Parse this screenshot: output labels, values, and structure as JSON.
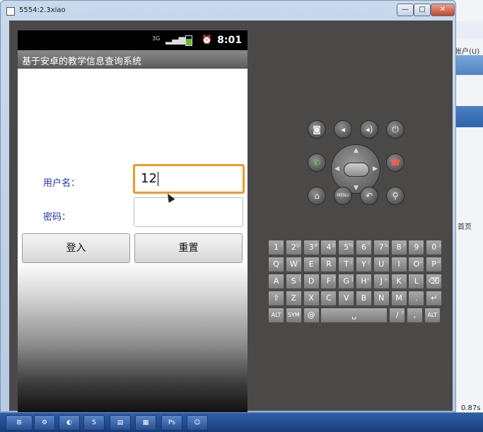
{
  "window": {
    "title": "5554:2.3xiao",
    "minimize_label": "—",
    "maximize_label": "□",
    "close_label": "✕"
  },
  "status_bar": {
    "network_label": "3G",
    "time": "8:01"
  },
  "app": {
    "title": "基于安卓的教学信息查询系统",
    "username_label": "用户名：",
    "username_value": "12",
    "password_label": "密码：",
    "login_button": "登入",
    "reset_button": "重置"
  },
  "hardware": {
    "menu_label": "MENU"
  },
  "keyboard": {
    "rows": [
      [
        {
          "k": "1",
          "a": "!"
        },
        {
          "k": "2",
          "a": "@"
        },
        {
          "k": "3",
          "a": "#"
        },
        {
          "k": "4",
          "a": "$"
        },
        {
          "k": "5",
          "a": "%"
        },
        {
          "k": "6",
          "a": "^"
        },
        {
          "k": "7",
          "a": "&"
        },
        {
          "k": "8",
          "a": "*"
        },
        {
          "k": "9",
          "a": "("
        },
        {
          "k": "0",
          "a": ")"
        }
      ],
      [
        {
          "k": "Q",
          "a": "~"
        },
        {
          "k": "W",
          "a": "\""
        },
        {
          "k": "E",
          "a": "´"
        },
        {
          "k": "R",
          "a": ""
        },
        {
          "k": "T",
          "a": "{"
        },
        {
          "k": "Y",
          "a": "}"
        },
        {
          "k": "U",
          "a": "-"
        },
        {
          "k": "I",
          "a": ""
        },
        {
          "k": "O",
          "a": "+"
        },
        {
          "k": "P",
          "a": "="
        }
      ],
      [
        {
          "k": "A",
          "a": ""
        },
        {
          "k": "S",
          "a": "\\"
        },
        {
          "k": "D",
          "a": ""
        },
        {
          "k": "F",
          "a": "["
        },
        {
          "k": "G",
          "a": "]"
        },
        {
          "k": "H",
          "a": "<"
        },
        {
          "k": "J",
          "a": ">"
        },
        {
          "k": "K",
          "a": ";"
        },
        {
          "k": "L",
          "a": ":"
        },
        {
          "k": "⌫",
          "a": "DEL"
        }
      ],
      [
        {
          "k": "⇧",
          "a": ""
        },
        {
          "k": "Z",
          "a": ""
        },
        {
          "k": "X",
          "a": ""
        },
        {
          "k": "C",
          "a": ""
        },
        {
          "k": "V",
          "a": ""
        },
        {
          "k": "B",
          "a": ""
        },
        {
          "k": "N",
          "a": ""
        },
        {
          "k": "M",
          "a": ""
        },
        {
          "k": ".",
          "a": ""
        },
        {
          "k": "↵",
          "a": ""
        }
      ],
      [
        {
          "k": "ALT",
          "a": ""
        },
        {
          "k": "SYM",
          "a": ""
        },
        {
          "k": "@",
          "a": ""
        },
        {
          "k": "␣",
          "a": ""
        },
        {
          "k": "/",
          "a": "?"
        },
        {
          "k": ",",
          "a": ""
        },
        {
          "k": "ALT",
          "a": ""
        }
      ]
    ]
  },
  "background": {
    "account_text": "帐户(U)",
    "page_text": "首页",
    "zoom_text": "0.87s"
  }
}
